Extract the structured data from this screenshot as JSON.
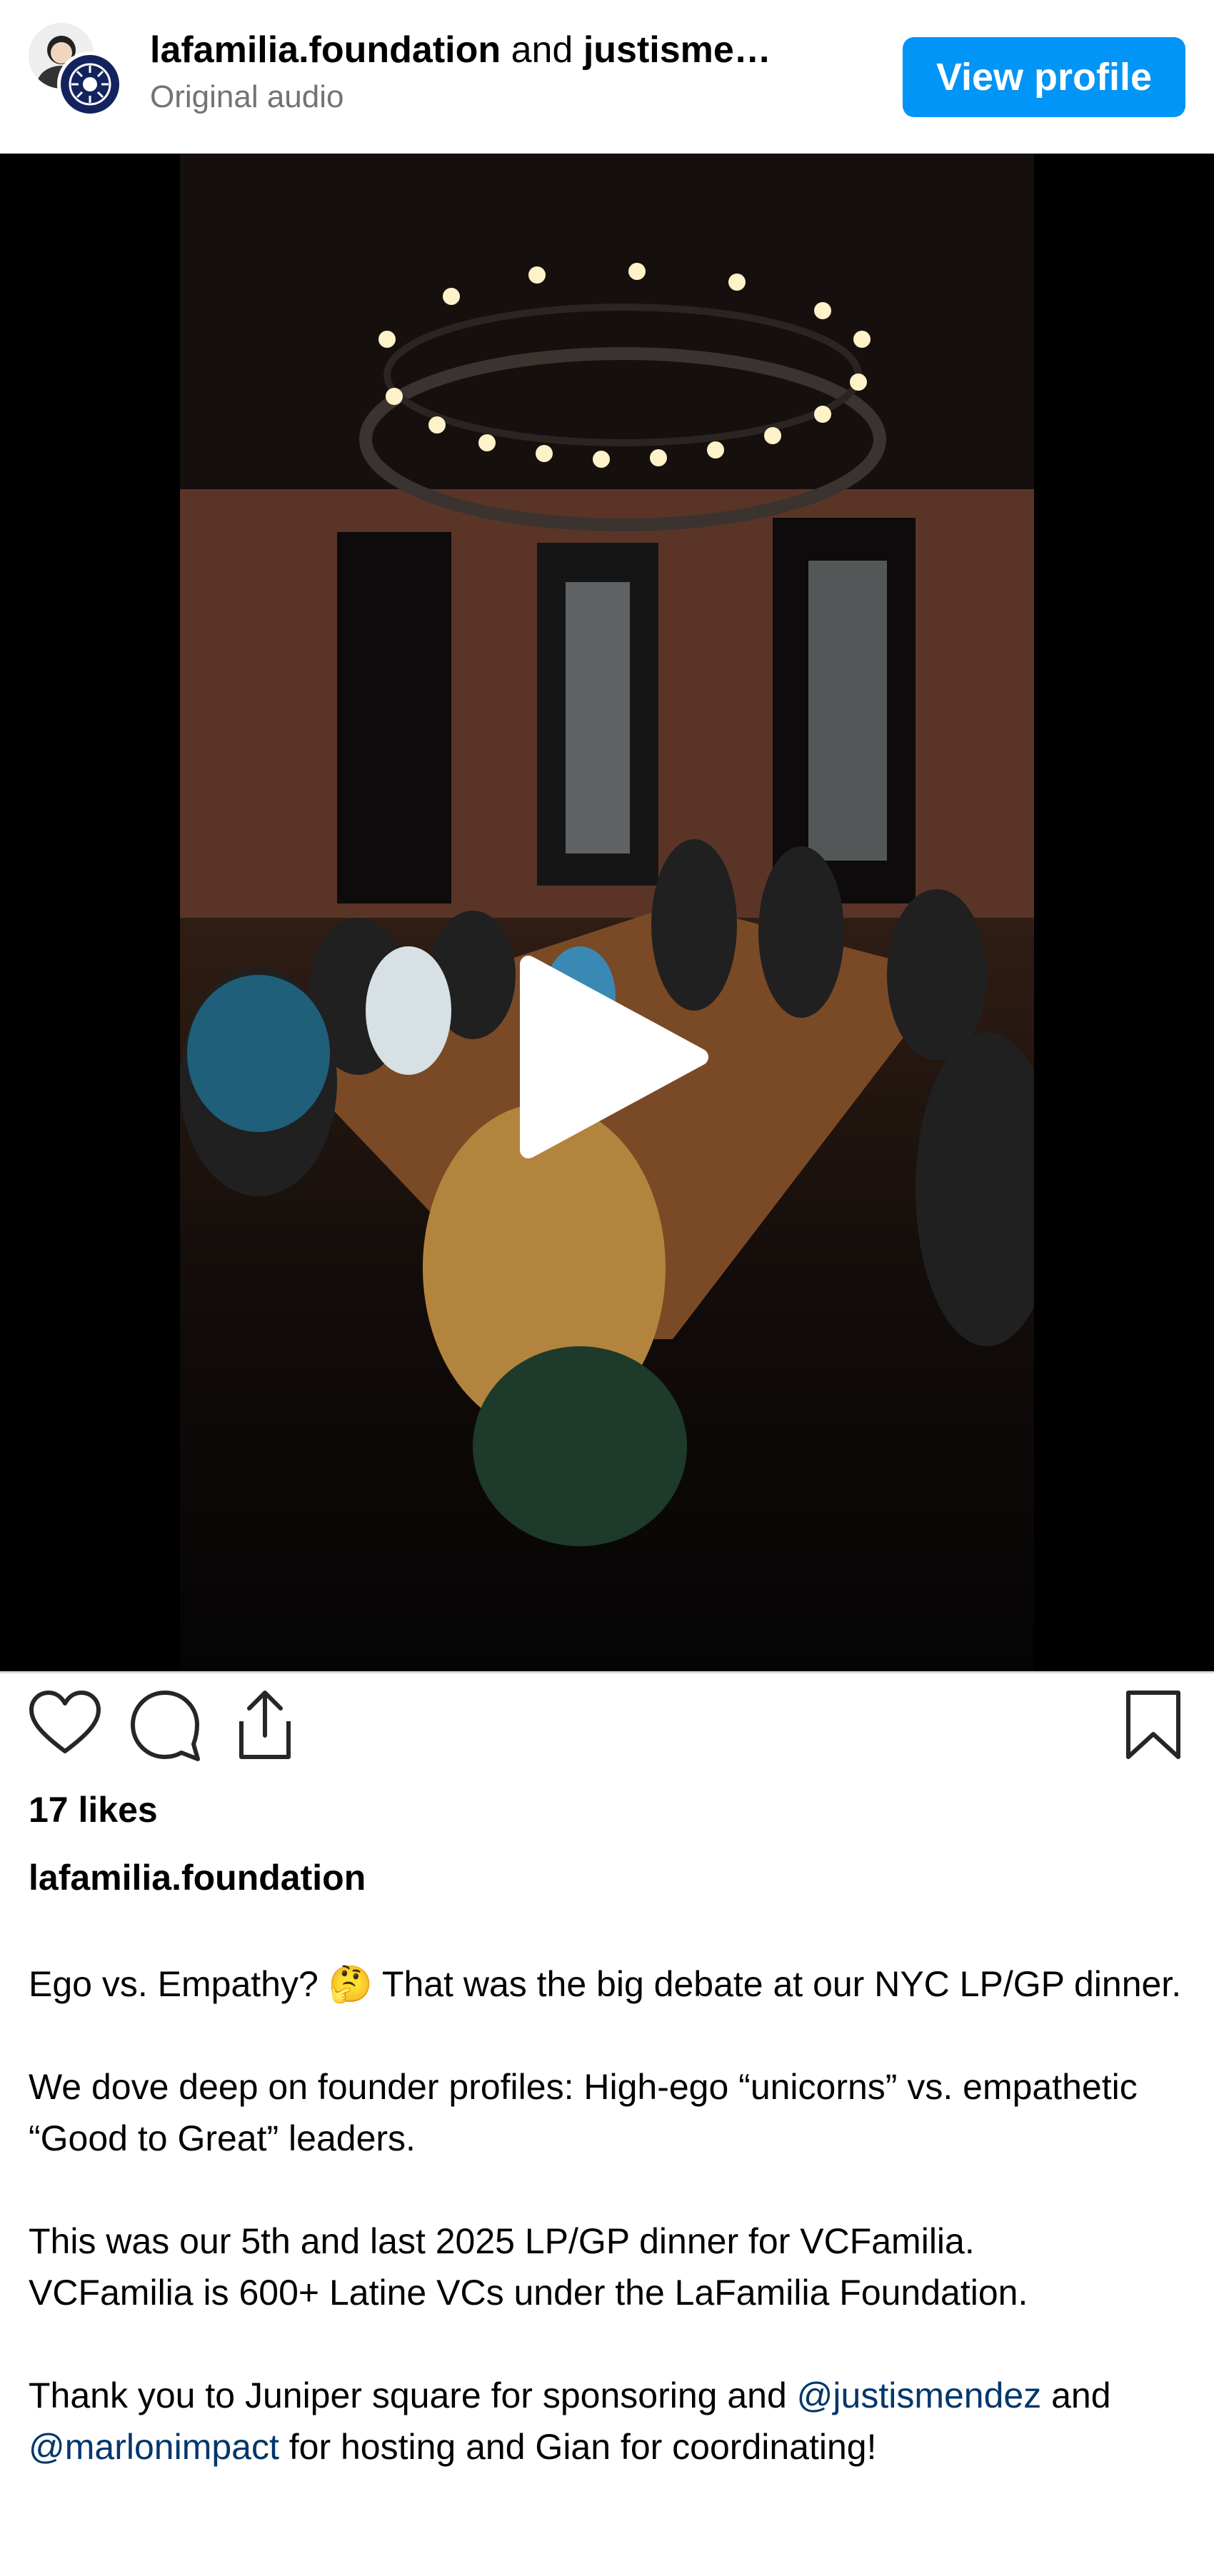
{
  "header": {
    "account_1": "lafamilia.foundation",
    "joiner": "and",
    "account_2": "justisme…",
    "audio": "Original audio",
    "view_profile": "View profile"
  },
  "post": {
    "likes": "17 likes",
    "author": "lafamilia.foundation",
    "caption": {
      "p1": "Ego vs. Empathy? 🤔 That was the big debate at our NYC LP/GP dinner.",
      "p2": "We dove deep on founder profiles: High-ego “unicorns” vs. empathetic “Good to Great” leaders.",
      "p3_line1": "This was our 5th and last 2025 LP/GP dinner for VCFamilia.",
      "p3_line2": "VCFamilia is 600+ Latine VCs under the LaFamilia Foundation.",
      "p4_start": "Thank you to Juniper square for sponsoring and ",
      "p4_mention1": "@justismendez",
      "p4_mid": " and ",
      "p4_mention2": "@marlonimpact",
      "p4_end": " for hosting and Gian for coordinating!"
    }
  },
  "colors": {
    "accent": "#0095f6",
    "mention": "#00376b",
    "secondary_text": "#737373"
  },
  "icons": [
    "heart-icon",
    "comment-icon",
    "share-icon",
    "bookmark-icon",
    "play-icon"
  ]
}
